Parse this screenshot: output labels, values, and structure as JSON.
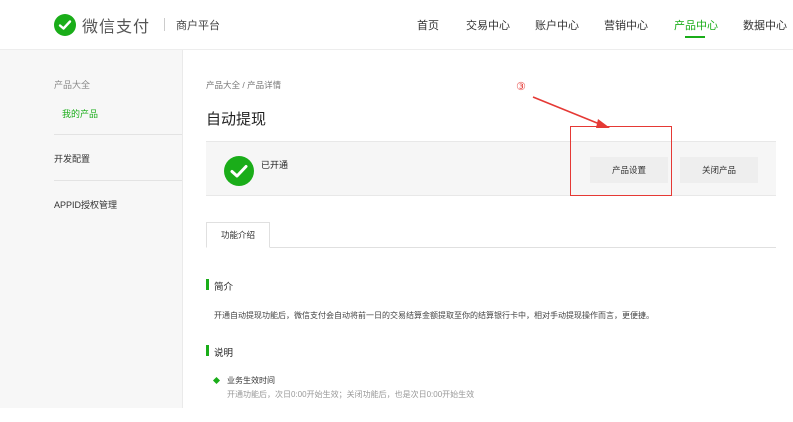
{
  "header": {
    "logo_text": "微信支付",
    "platform": "商户平台",
    "nav": [
      "首页",
      "交易中心",
      "账户中心",
      "营销中心",
      "产品中心",
      "数据中心"
    ],
    "active_nav": "产品中心"
  },
  "sidebar": {
    "group_title": "产品大全",
    "active_item": "我的产品",
    "items": [
      "开发配置",
      "APPID授权管理"
    ]
  },
  "main": {
    "breadcrumb": "产品大全 / 产品详情",
    "title": "自动提现",
    "status": "已开通",
    "buttons": {
      "settings": "产品设置",
      "close": "关闭产品"
    },
    "tab": "功能介绍",
    "intro": {
      "title": "简介",
      "text": "开通自动提现功能后，微信支付会自动将前一日的交易结算金额提取至你的结算银行卡中，相对手动提现操作而言，更便捷。"
    },
    "notes": {
      "title": "说明",
      "item_title": "业务生效时间",
      "item_desc": "开通功能后，次日0:00开始生效；关闭功能后，也是次日0:00开始生效"
    }
  },
  "annotation": {
    "number": "③",
    "color": "#e53935"
  },
  "colors": {
    "accent": "#1aad19"
  }
}
